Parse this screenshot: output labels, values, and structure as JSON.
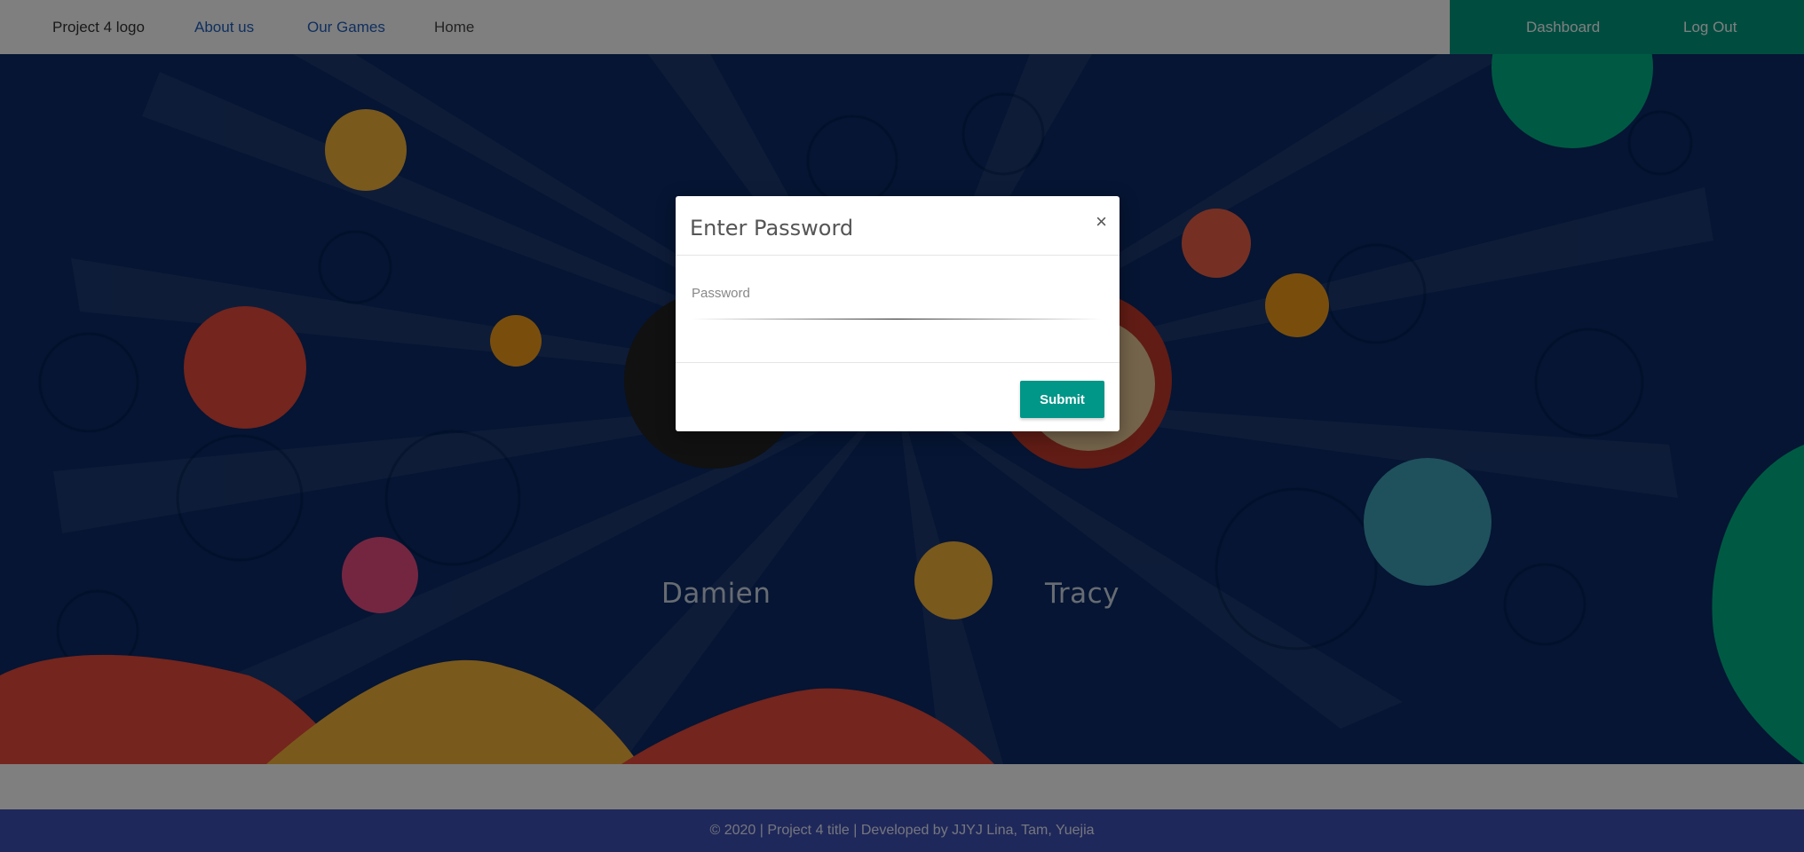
{
  "nav": {
    "logo": "Project 4 logo",
    "about": "About us",
    "games": "Our Games",
    "home": "Home",
    "dashboard": "Dashboard",
    "logout": "Log Out"
  },
  "profiles": [
    {
      "name": "Damien"
    },
    {
      "name": "Tracy"
    }
  ],
  "modal": {
    "title": "Enter Password",
    "close": "×",
    "password_label": "Password",
    "submit": "Submit"
  },
  "footer": {
    "text": "© 2020 | Project 4 title | Developed by JJYJ Lina, Tam, Yuejia"
  },
  "colors": {
    "nav_right_bg": "#009a80",
    "hero_bg": "#0a2a66",
    "footer_bg": "#3f51b5",
    "submit_bg": "#009688",
    "link": "#1f5fbf"
  }
}
